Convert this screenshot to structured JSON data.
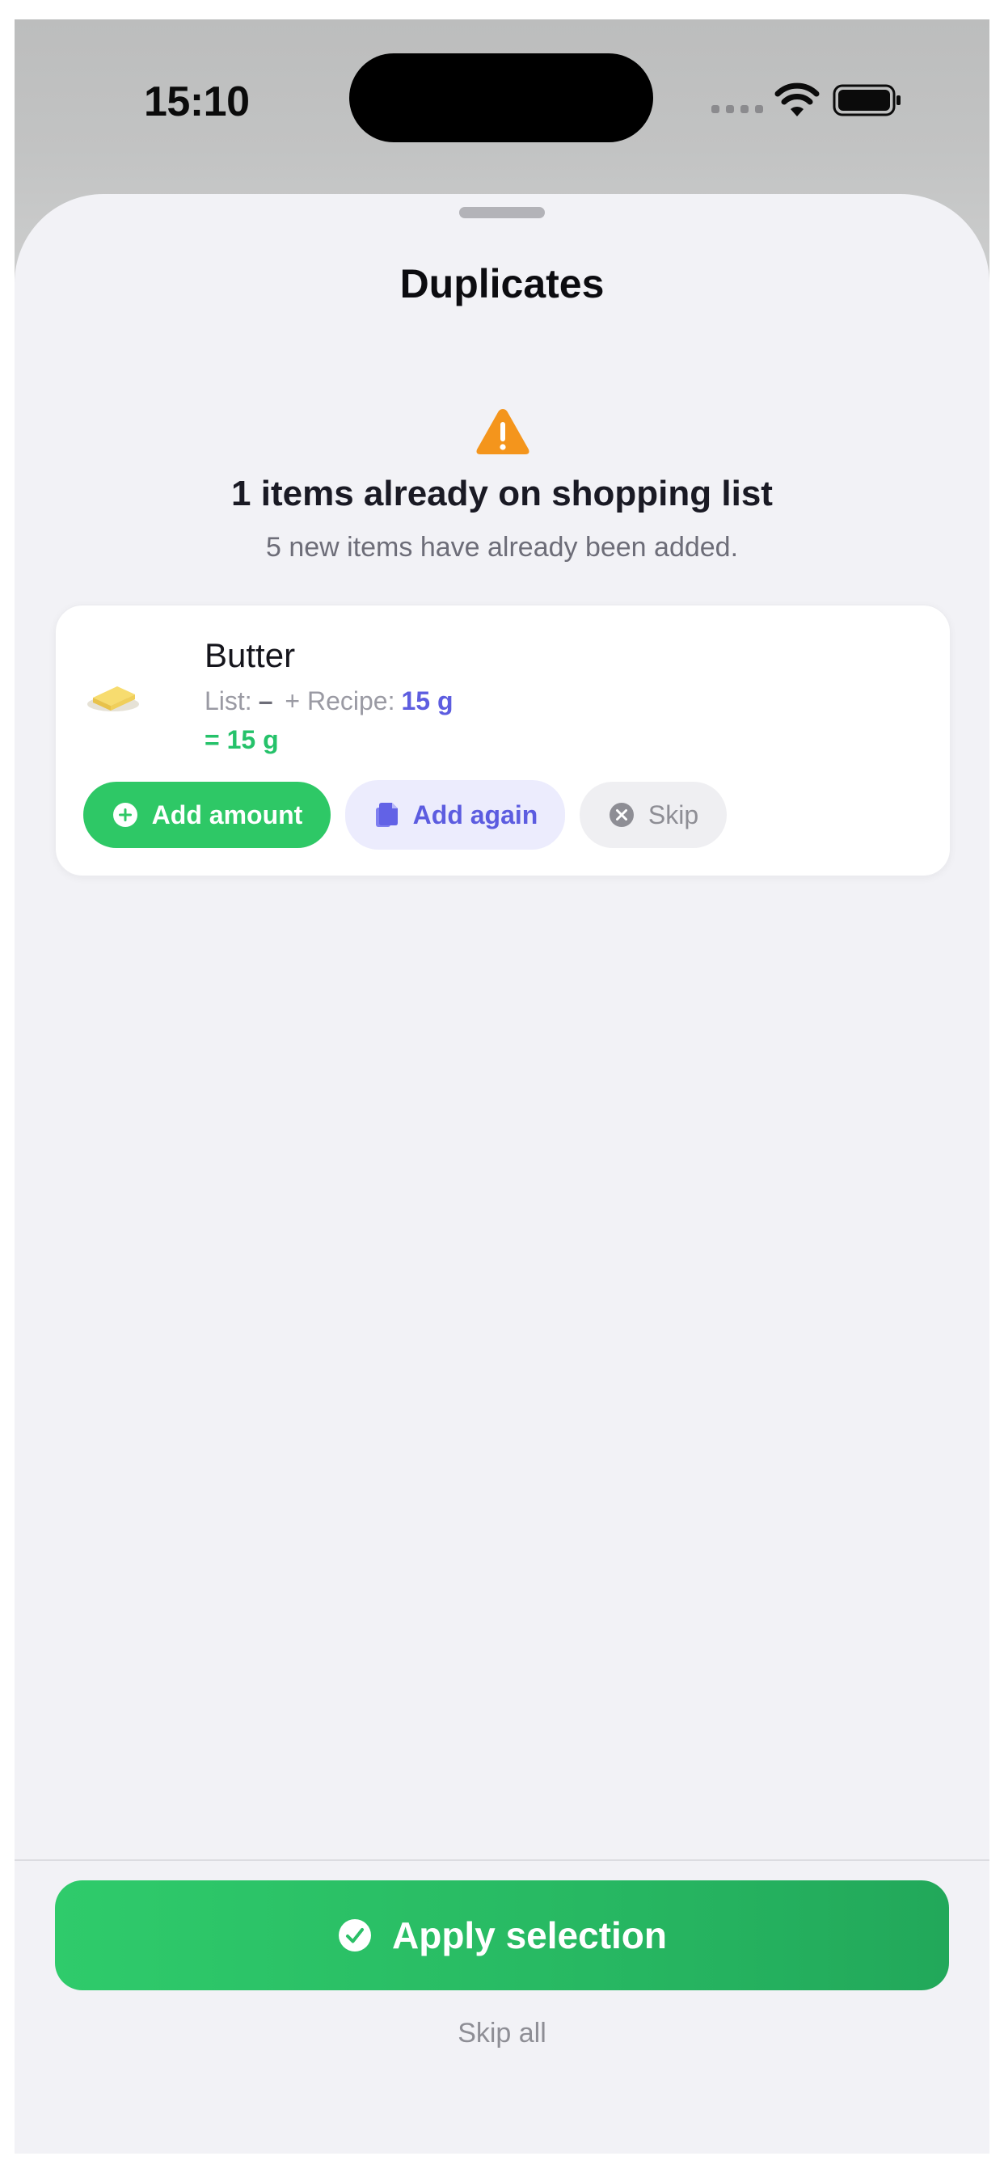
{
  "status_bar": {
    "time": "15:10"
  },
  "sheet": {
    "title": "Duplicates",
    "headline": "1 items already on shopping list",
    "subline": "5 new items have already been added."
  },
  "item": {
    "icon": "butter-icon",
    "name": "Butter",
    "list_label": "List:",
    "list_value": "–",
    "plus": "+",
    "recipe_label": "Recipe:",
    "recipe_value": "15 g",
    "total": "= 15 g",
    "actions": {
      "add_amount": "Add amount",
      "add_again": "Add again",
      "skip": "Skip"
    }
  },
  "footer": {
    "apply_label": "Apply selection",
    "skip_all_label": "Skip all"
  },
  "colors": {
    "accent_green": "#2ec866",
    "accent_purple": "#5c5ce0",
    "warning": "#f4951c"
  }
}
